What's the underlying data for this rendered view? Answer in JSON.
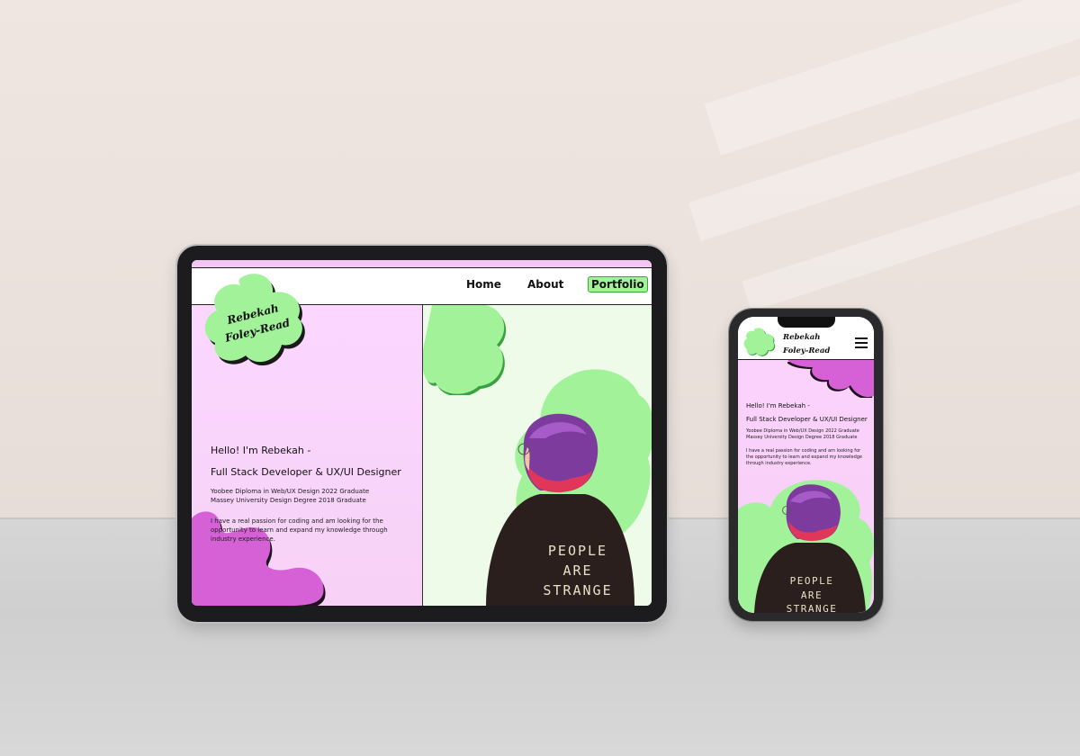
{
  "tablet": {
    "logo_line1": "Rebekah",
    "logo_line2": "Foley-Read",
    "nav": {
      "home": "Home",
      "about": "About",
      "portfolio": "Portfolio"
    },
    "hero_title": "Hello! I'm Rebekah -",
    "hero_role": "Full Stack Developer & UX/UI Designer",
    "credential1": "Yoobee Diploma in Web/UX Design 2022 Graduate",
    "credential2": "Massey University Design Degree 2018 Graduate",
    "intro": "I have a real passion for coding and am looking for the opportunity to learn and expand my knowledge through industry experience.",
    "shirt_line1": "PEOPLE",
    "shirt_line2": "ARE",
    "shirt_line3": "STRANGE"
  },
  "phone": {
    "logo_line1": "Rebekah",
    "logo_line2": "Foley-Read",
    "hero_title": "Hello! I'm Rebekah -",
    "hero_role": "Full Stack Developer & UX/UI Designer",
    "credential1": "Yoobee Diploma in Web/UX Design 2022 Graduate",
    "credential2": "Massey University Design Degree 2018 Graduate",
    "intro": "I have a real passion for coding and am looking for the opportunity to learn and expand my knowledge through industry experience.",
    "shirt_line1": "PEOPLE",
    "shirt_line2": "ARE",
    "shirt_line3": "STRANGE"
  },
  "icons": {
    "menu": "hamburger-menu-icon",
    "logo_blob": "flower-blob-logo"
  },
  "colors": {
    "pink_bg": "#fbd6ff",
    "green_blob": "#a2f29a",
    "purple_blob": "#d660d6",
    "light_green_bg": "#edfbe8"
  }
}
